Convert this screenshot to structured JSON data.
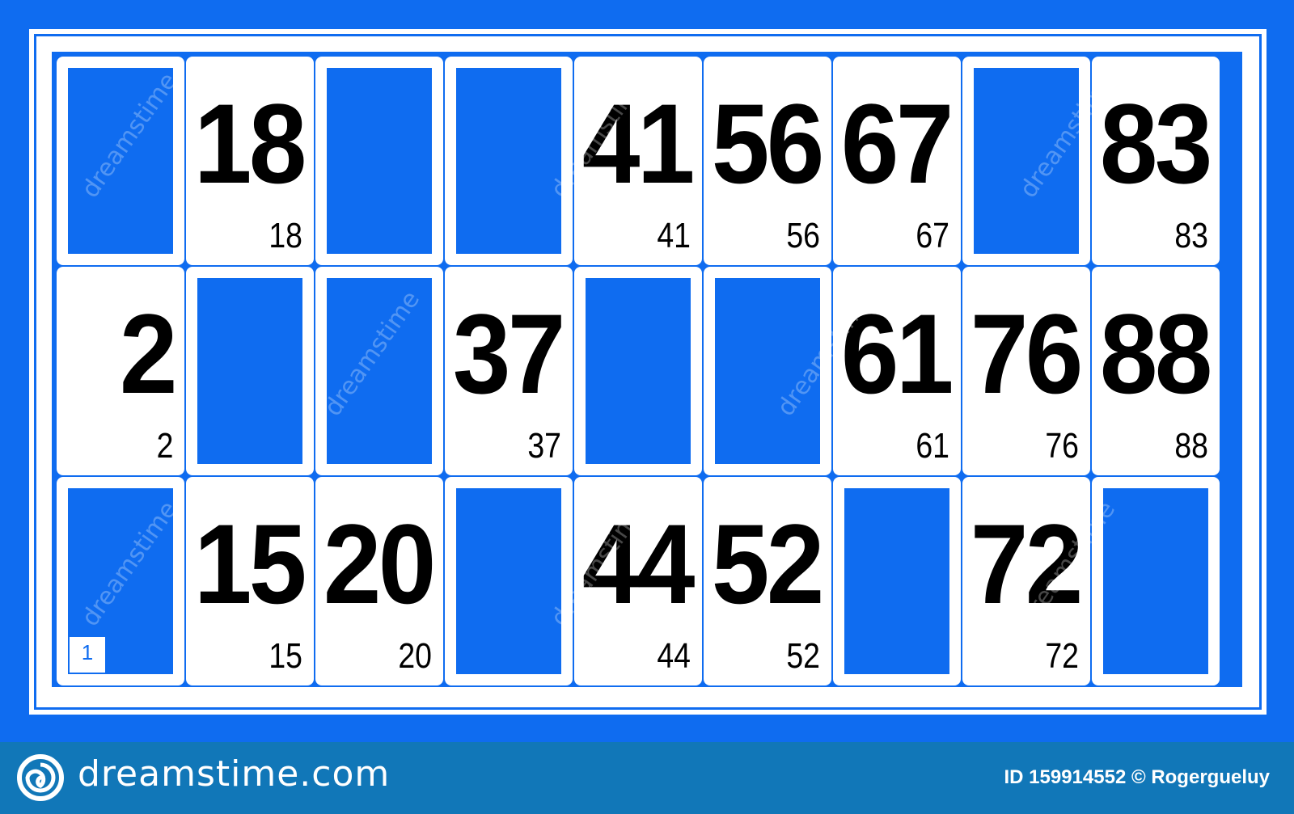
{
  "colors": {
    "background": "#0f6cf0",
    "cell": "#ffffff",
    "number": "#000000",
    "footer": "#1177b8"
  },
  "card": {
    "id": "1",
    "rows": [
      [
        null,
        18,
        null,
        null,
        41,
        56,
        67,
        null,
        83
      ],
      [
        2,
        null,
        null,
        37,
        null,
        null,
        61,
        76,
        88
      ],
      [
        null,
        15,
        20,
        null,
        44,
        52,
        null,
        72,
        null
      ]
    ]
  },
  "footer": {
    "site": "dreamstime.com",
    "credit": "ID 159914552 © Rogergueluy",
    "logo_icon": "spiral-logo-icon"
  },
  "watermark": "dreamstime"
}
